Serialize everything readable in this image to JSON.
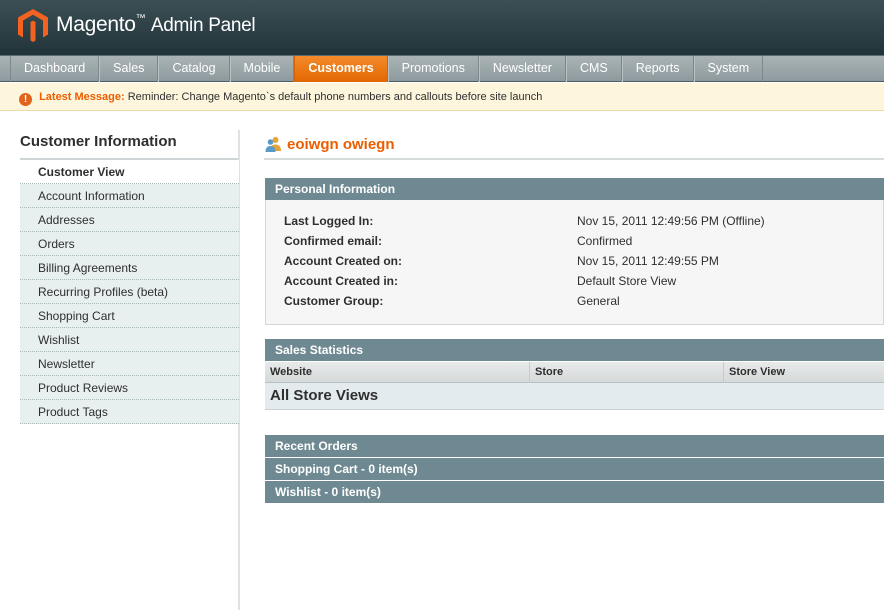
{
  "header": {
    "brand": "Magento",
    "trademark": "™",
    "subtitle": "Admin Panel",
    "logo_icon": "magento-logo-icon"
  },
  "nav": {
    "items": [
      {
        "label": "Dashboard"
      },
      {
        "label": "Sales"
      },
      {
        "label": "Catalog"
      },
      {
        "label": "Mobile"
      },
      {
        "label": "Customers",
        "active": true
      },
      {
        "label": "Promotions"
      },
      {
        "label": "Newsletter"
      },
      {
        "label": "CMS"
      },
      {
        "label": "Reports"
      },
      {
        "label": "System"
      }
    ],
    "accent_color": "#eb5e00"
  },
  "message": {
    "icon": "alert-icon",
    "title": "Latest Message:",
    "text": "Reminder: Change Magento`s default phone numbers and callouts before site launch"
  },
  "sidebar": {
    "title": "Customer Information",
    "tabs": [
      {
        "label": "Customer View",
        "active": true
      },
      {
        "label": "Account Information"
      },
      {
        "label": "Addresses"
      },
      {
        "label": "Orders"
      },
      {
        "label": "Billing Agreements"
      },
      {
        "label": "Recurring Profiles (beta)"
      },
      {
        "label": "Shopping Cart"
      },
      {
        "label": "Wishlist"
      },
      {
        "label": "Newsletter"
      },
      {
        "label": "Product Reviews"
      },
      {
        "label": "Product Tags"
      }
    ]
  },
  "main": {
    "customer_name": "eoiwgn owiegn",
    "customer_icon": "customer-icon",
    "personal_info": {
      "title": "Personal Information",
      "rows": [
        {
          "label": "Last Logged In:",
          "value": "Nov 15, 2011 12:49:56 PM (Offline)"
        },
        {
          "label": "Confirmed email:",
          "value": "Confirmed"
        },
        {
          "label": "Account Created on:",
          "value": "Nov 15, 2011 12:49:55 PM"
        },
        {
          "label": "Account Created in:",
          "value": "Default Store View"
        },
        {
          "label": "Customer Group:",
          "value": "General"
        }
      ]
    },
    "sales_statistics": {
      "title": "Sales Statistics",
      "columns": [
        "Website",
        "Store",
        "Store View"
      ],
      "total_row": "All Store Views"
    },
    "accordions": [
      "Recent Orders",
      "Shopping Cart - 0 item(s)",
      "Wishlist - 0 item(s)"
    ]
  }
}
